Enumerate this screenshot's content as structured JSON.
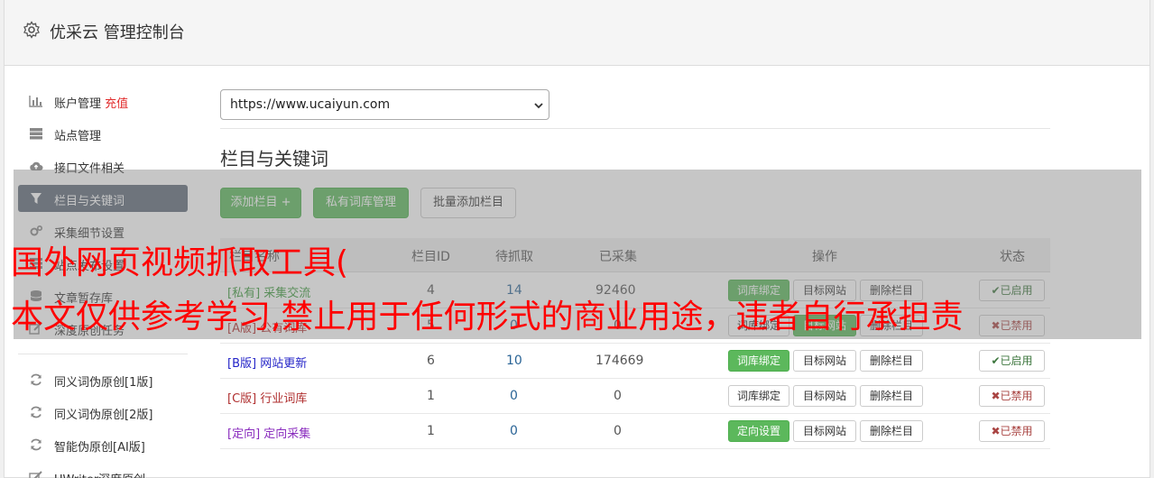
{
  "header": {
    "title": "优采云 管理控制台",
    "icon": "gear-icon"
  },
  "sidebar": {
    "items": [
      {
        "label": "账户管理",
        "badge": "充值",
        "icon": "bar-chart-icon"
      },
      {
        "label": "站点管理",
        "icon": "server-icon"
      },
      {
        "label": "接口文件相关",
        "icon": "cloud-upload-icon"
      },
      {
        "label": "栏目与关键词",
        "icon": "filter-icon",
        "active": true
      },
      {
        "label": "采集细节设置",
        "icon": "cogs-icon"
      },
      {
        "label": "站点发布设置",
        "icon": "tasks-icon"
      },
      {
        "label": "文章暂存库",
        "icon": "database-icon"
      },
      {
        "label": "深度原创任务",
        "icon": "edit-icon"
      },
      {
        "label": "同义词伪原创[1版]",
        "icon": "refresh-icon"
      },
      {
        "label": "同义词伪原创[2版]",
        "icon": "refresh-icon"
      },
      {
        "label": "智能伪原创[AI版]",
        "icon": "refresh-icon"
      },
      {
        "label": "UWriter深度原创",
        "icon": "pencil-icon"
      }
    ]
  },
  "site_select": {
    "value": "https://www.ucaiyun.com"
  },
  "section_title": "栏目与关键词",
  "toolbar": {
    "add_column": "添加栏目 +",
    "private_lib": "私有词库管理",
    "batch_add": "批量添加栏目"
  },
  "table": {
    "headers": [
      "栏目名称",
      "栏目ID",
      "待抓取",
      "已采集",
      "操作",
      "状态"
    ],
    "rows": [
      {
        "tag": "[私有]",
        "name": "采集交流",
        "id": "4",
        "pending": "14",
        "collected": "92460",
        "action1": "词库绑定",
        "action2": "目标网站",
        "action3": "删除栏目",
        "status": "已启用"
      },
      {
        "tag": "[A版]",
        "name": "公有词库",
        "id": "5",
        "pending": "0",
        "collected": "0",
        "action1": "词库绑定",
        "action2": "目标网站",
        "action3": "删除栏目",
        "status": "已禁用"
      },
      {
        "tag": "[B版]",
        "name": "网站更新",
        "id": "6",
        "pending": "10",
        "collected": "174669",
        "action1": "词库绑定",
        "action2": "目标网站",
        "action3": "删除栏目",
        "status": "已启用"
      },
      {
        "tag": "[C版]",
        "name": "行业词库",
        "id": "1",
        "pending": "0",
        "collected": "0",
        "action1": "词库绑定",
        "action2": "目标网站",
        "action3": "删除栏目",
        "status": "已禁用"
      },
      {
        "tag": "[定向]",
        "name": "定向采集",
        "id": "1",
        "pending": "0",
        "collected": "0",
        "action1": "定向设置",
        "action2": "目标网站",
        "action3": "删除栏目",
        "status": "已禁用"
      }
    ]
  },
  "watermark": {
    "line1": "国外网页视频抓取工具(",
    "line2": "本文仅供参考学习,禁止用于任何形式的商业用途，违者自行承担责"
  },
  "colors": {
    "accent_green": "#5cb85c",
    "active_nav": "#5f6b79",
    "watermark": "#ff0000",
    "tag_private": "#3c9a3c",
    "tag_b": "#2525c8",
    "tag_c": "#b03030",
    "tag_dir": "#8a2cbe"
  }
}
